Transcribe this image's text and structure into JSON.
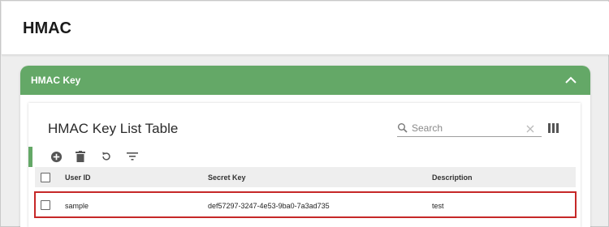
{
  "page": {
    "title": "HMAC"
  },
  "panel": {
    "title": "HMAC Key",
    "collapse_icon": "chevron-up-icon"
  },
  "table_card": {
    "title": "HMAC Key List Table",
    "search": {
      "placeholder": "Search",
      "value": ""
    },
    "toolbar": {
      "actions": [
        {
          "name": "add",
          "icon": "add-circle-icon"
        },
        {
          "name": "delete",
          "icon": "trash-icon"
        },
        {
          "name": "refresh",
          "icon": "refresh-icon"
        },
        {
          "name": "filter",
          "icon": "filter-icon"
        }
      ]
    },
    "columns": [
      "User ID",
      "Secret Key",
      "Description"
    ],
    "rows": [
      {
        "user_id": "sample",
        "secret_key": "def57297-3247-4e53-9ba0-7a3ad735",
        "description": "test",
        "highlighted": true
      }
    ]
  },
  "colors": {
    "accent_green": "#64a867",
    "highlight_red": "#c62828",
    "header_bg": "#eeeeee"
  }
}
